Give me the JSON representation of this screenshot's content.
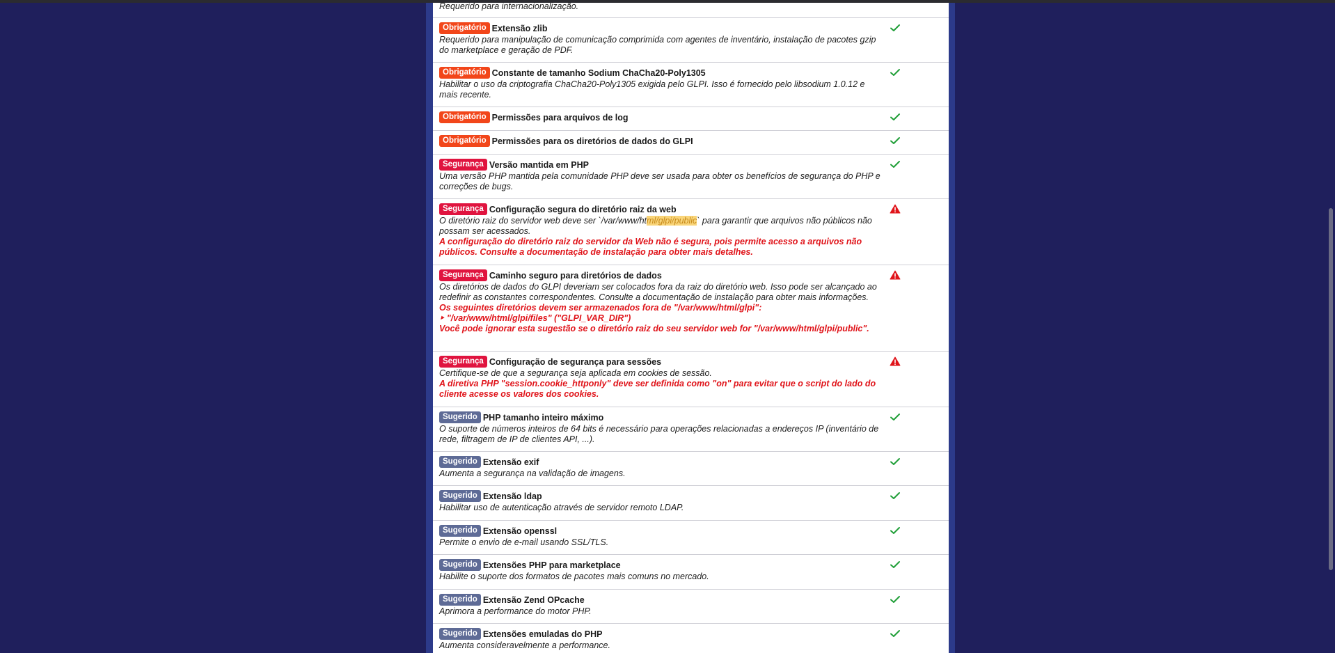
{
  "badges": {
    "required": "Obrigatório",
    "security": "Segurança",
    "suggested": "Sugerido"
  },
  "colors": {
    "background": "#1f1f5c",
    "required": "#f2461a",
    "security": "#e0143f",
    "suggested": "#5e6b96",
    "ok": "#1e9e36",
    "warning": "#e0141a"
  },
  "status_icons": {
    "ok": "check-icon",
    "warning": "warning-triangle-icon"
  },
  "requirements": [
    {
      "title": "",
      "desc": "Requerido para internacionalização."
    },
    {
      "title": "Extensão zlib",
      "desc": "Requerido para manipulação de comunicação comprimida com agentes de inventário, instalação de pacotes gzip do marketplace e geração de PDF."
    },
    {
      "title": "Constante de tamanho Sodium ChaCha20-Poly1305",
      "desc": "Habilitar o uso da criptografia ChaCha20-Poly1305 exigida pelo GLPI. Isso é fornecido pelo libsodium 1.0.12 e mais recente."
    },
    {
      "title": "Permissões para arquivos de log"
    },
    {
      "title": "Permissões para os diretórios de dados do GLPI"
    },
    {
      "title": "Versão mantida em PHP",
      "desc": "Uma versão PHP mantida pela comunidade PHP deve ser usada para obter os benefícios de segurança do PHP e correções de bugs."
    },
    {
      "title": "Configuração segura do diretório raiz da web",
      "desc_before": "O diretório raiz do servidor web deve ser `/var/www/ht",
      "desc_highlight": "ml/glpi/public",
      "desc_after": "` para garantir que arquivos não públicos não possam ser acessados.",
      "error": "A configuração do diretório raiz do servidor da Web não é segura, pois permite acesso a arquivos não públicos. Consulte a documentação de instalação para obter mais detalhes."
    },
    {
      "title": "Caminho seguro para diretórios de dados",
      "desc": "Os diretórios de dados do GLPI deveriam ser colocados fora da raiz do diretório web. Isso pode ser alcançado ao redefinir as constantes correspondentes. Consulte a documentação de instalação para obter mais informações.",
      "error1": "Os seguintes diretórios devem ser armazenados fora de \"/var/www/html/glpi\":",
      "error2": "‣ \"/var/www/html/glpi/files\" (\"GLPI_VAR_DIR\")",
      "error3": "Você pode ignorar esta sugestão se o diretório raiz do seu servidor web for \"/var/www/html/glpi/public\"."
    },
    {
      "title": "Configuração de segurança para sessões",
      "desc": "Certifique-se de que a segurança seja aplicada em cookies de sessão.",
      "error": "A diretiva PHP \"session.cookie_httponly\" deve ser definida como \"on\" para evitar que o script do lado do cliente acesse os valores dos cookies."
    },
    {
      "title": "PHP tamanho inteiro máximo",
      "desc": "O suporte de números inteiros de 64 bits é necessário para operações relacionadas a endereços IP (inventário de rede, filtragem de IP de clientes API, ...)."
    },
    {
      "title": "Extensão exif",
      "desc": "Aumenta a segurança na validação de imagens."
    },
    {
      "title": "Extensão ldap",
      "desc": "Habilitar uso de autenticação através de servidor remoto LDAP."
    },
    {
      "title": "Extensão openssl",
      "desc": "Permite o envio de e-mail usando SSL/TLS."
    },
    {
      "title": "Extensões PHP para marketplace",
      "desc": "Habilite o suporte dos formatos de pacotes mais comuns no mercado."
    },
    {
      "title": "Extensão Zend OPcache",
      "desc": "Aprimora a performance do motor PHP."
    },
    {
      "title": "Extensões emuladas do PHP",
      "desc": "Aumenta consideravelmente a performance."
    }
  ]
}
